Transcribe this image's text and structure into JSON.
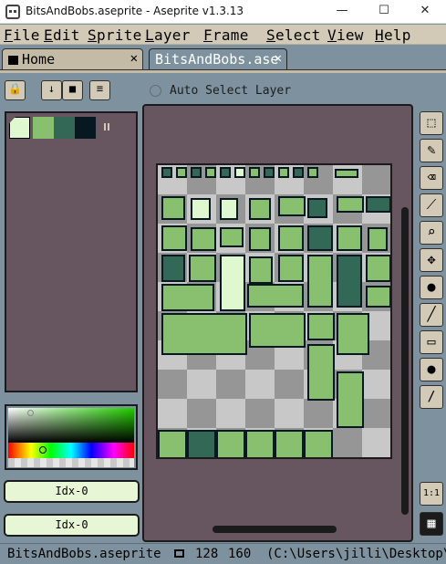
{
  "window": {
    "title": "BitsAndBobs.aseprite - Aseprite v1.3.13",
    "minimize": "—",
    "maximize": "☐",
    "close": "✕"
  },
  "menu": {
    "items": [
      {
        "first": "F",
        "rest": "ile"
      },
      {
        "first": "E",
        "rest": "dit"
      },
      {
        "first": "S",
        "rest": "prite"
      },
      {
        "first": "L",
        "rest": "ayer"
      },
      {
        "first": "F",
        "rest": "rame"
      },
      {
        "first": "S",
        "rest": "elect"
      },
      {
        "first": "V",
        "rest": "iew"
      },
      {
        "first": "H",
        "rest": "elp"
      }
    ]
  },
  "tabs": {
    "home": "Home",
    "active": "BitsAndBobs.ase",
    "close_glyph": "✕"
  },
  "toolbar": {
    "lock": "🔒",
    "down": "↓",
    "stop": "■",
    "menu": "≡",
    "auto_select_label": "Auto Select Layer"
  },
  "palette": {
    "colors": [
      "#e0f8d0",
      "#88c070",
      "#346856",
      "#081820"
    ]
  },
  "color_bar": {
    "fg_label": "Idx-0",
    "bg_label": "Idx-0"
  },
  "tools": {
    "icons": [
      "marquee-icon",
      "pencil-icon",
      "eraser-icon",
      "eyedropper-icon",
      "zoom-icon",
      "move-icon",
      "fill-icon",
      "line-icon",
      "rectangle-icon",
      "contour-icon",
      "blur-icon"
    ],
    "zoom_one": "1:1",
    "timeline": "▦"
  },
  "status": {
    "filename": "BitsAndBobs.aseprite",
    "width": "128",
    "height": "160",
    "path": "(C:\\Users\\jilli\\Desktop\\("
  }
}
